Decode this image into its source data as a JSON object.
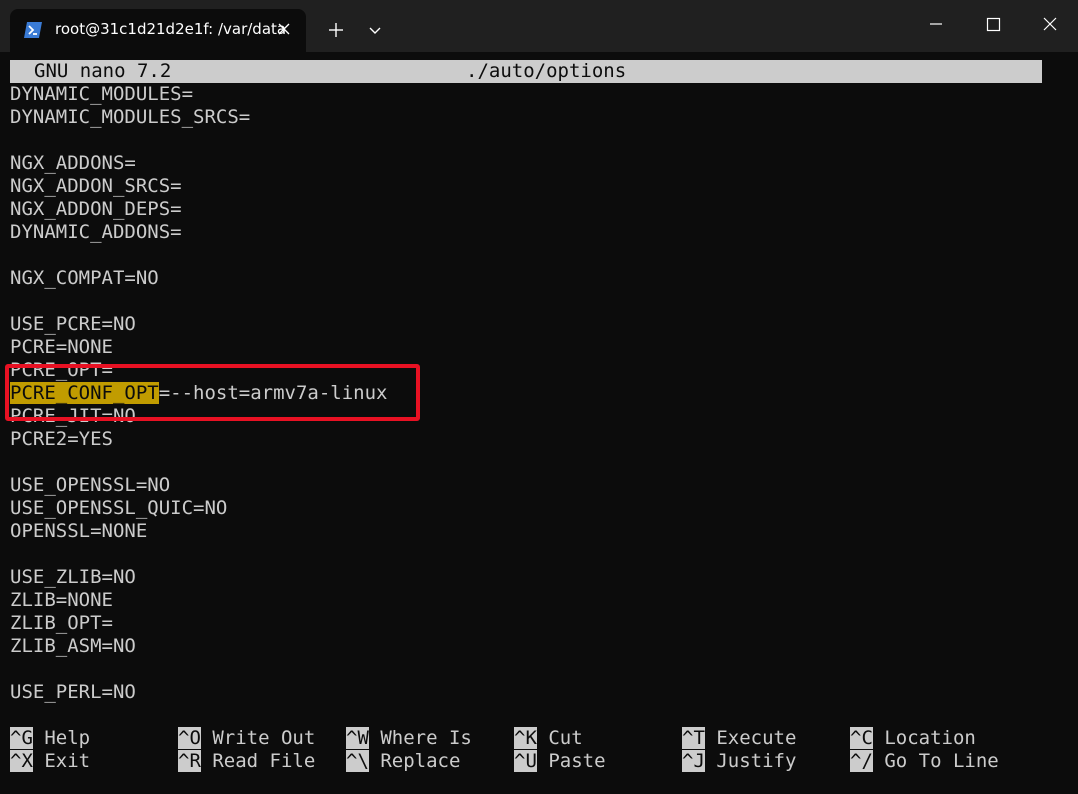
{
  "window": {
    "tab_title": "root@31c1d21d2e1f: /var/data"
  },
  "nano": {
    "version": "GNU nano 7.2",
    "filename": "./auto/options"
  },
  "lines": [
    "DYNAMIC_MODULES=",
    "DYNAMIC_MODULES_SRCS=",
    "",
    "NGX_ADDONS=",
    "NGX_ADDON_SRCS=",
    "NGX_ADDON_DEPS=",
    "DYNAMIC_ADDONS=",
    "",
    "NGX_COMPAT=NO",
    "",
    "USE_PCRE=NO",
    "PCRE=NONE",
    "PCRE_OPT=",
    "",
    "PCRE_JIT=NO",
    "PCRE2=YES",
    "",
    "USE_OPENSSL=NO",
    "USE_OPENSSL_QUIC=NO",
    "OPENSSL=NONE",
    "",
    "USE_ZLIB=NO",
    "ZLIB=NONE",
    "ZLIB_OPT=",
    "ZLIB_ASM=NO",
    "",
    "USE_PERL=NO"
  ],
  "highlighted_line": {
    "highlight": "PCRE_CONF_OPT",
    "rest": "=--host=armv7a-linux"
  },
  "shortcuts": [
    {
      "key": "^G",
      "label": "Help"
    },
    {
      "key": "^O",
      "label": "Write Out"
    },
    {
      "key": "^W",
      "label": "Where Is"
    },
    {
      "key": "^K",
      "label": "Cut"
    },
    {
      "key": "^T",
      "label": "Execute"
    },
    {
      "key": "^C",
      "label": "Location"
    },
    {
      "key": "^X",
      "label": "Exit"
    },
    {
      "key": "^R",
      "label": "Read File"
    },
    {
      "key": "^\\",
      "label": "Replace"
    },
    {
      "key": "^U",
      "label": "Paste"
    },
    {
      "key": "^J",
      "label": "Justify"
    },
    {
      "key": "^/",
      "label": "Go To Line"
    }
  ],
  "colors": {
    "background": "#0c0c0c",
    "text": "#cccccc",
    "highlight": "#c19c00",
    "annotation_box": "#e81123"
  }
}
